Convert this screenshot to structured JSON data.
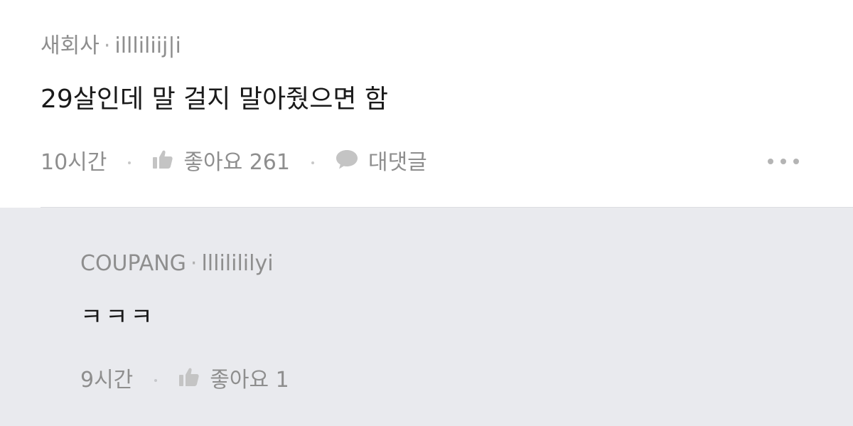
{
  "comment": {
    "company": "새회사",
    "separator": "·",
    "handle": "illliliij|i",
    "text": "29살인데 말 걸지 말아줬으면 함",
    "time": "10시간",
    "like_label": "좋아요 261",
    "reply_label": "대댓글",
    "icons": [
      "thumbs-up-icon",
      "speech-bubble-icon",
      "more-icon"
    ]
  },
  "reply": {
    "company": "COUPANG",
    "separator": "·",
    "handle": "lllilililyi",
    "text": "ㅋㅋㅋ",
    "time": "9시간",
    "like_label": "좋아요 1",
    "icons": [
      "thumbs-up-icon"
    ]
  },
  "colors": {
    "meta_text": "#8e8e8e",
    "body_text": "#1a1a1a",
    "reply_background": "#e9eaee",
    "icon": "#c4c4c4"
  }
}
